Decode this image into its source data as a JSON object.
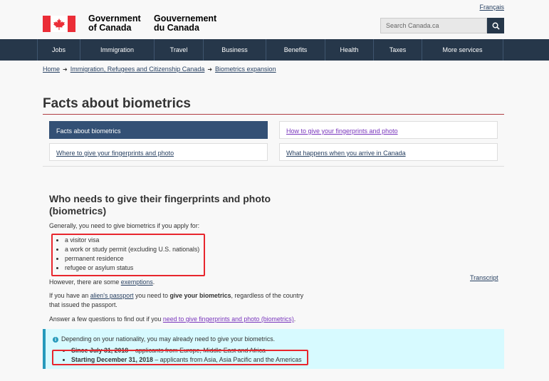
{
  "header": {
    "lang_link": "Français",
    "signature_en": [
      "Government",
      "of Canada"
    ],
    "signature_fr": [
      "Gouvernement",
      "du Canada"
    ],
    "search_placeholder": "Search Canada.ca"
  },
  "nav": [
    "Jobs",
    "Immigration",
    "Travel",
    "Business",
    "Benefits",
    "Health",
    "Taxes",
    "More services"
  ],
  "breadcrumb": [
    "Home",
    "Immigration, Refugees and Citizenship Canada",
    "Biometrics expansion"
  ],
  "page_title": "Facts about biometrics",
  "tiles": [
    {
      "label": "Facts about biometrics",
      "state": "active"
    },
    {
      "label": "How to give your fingerprints and photo",
      "state": "visited"
    },
    {
      "label": "Where to give your fingerprints and photo",
      "state": "link"
    },
    {
      "label": "What happens when you arrive in Canada",
      "state": "link"
    }
  ],
  "section": {
    "heading": "Who needs to give their fingerprints and photo (biometrics)",
    "intro": "Generally, you need to give biometrics if you apply for:",
    "list": [
      "a visitor visa",
      "a work or study permit (excluding U.S. nationals)",
      "permanent residence",
      "refugee or asylum status"
    ],
    "exemptions_pre": "However, there are some ",
    "exemptions_link": "exemptions",
    "exemptions_post": ".",
    "alien_pre": "If you have an ",
    "alien_link": "alien's passport",
    "alien_mid": " you need to ",
    "alien_bold": "give your biometrics",
    "alien_post": ", regardless of the country",
    "alien_line2": "that issued the passport.",
    "answer_pre": "Answer a few questions to find out if you ",
    "answer_link": "need to give fingerprints and photo (biometrics)",
    "answer_post": ".",
    "transcript": "Transcript"
  },
  "alert": {
    "text": "Depending on your nationality, you may already need to give your biometrics.",
    "items": [
      {
        "bold": "Since July 31, 2018",
        "rest": " – applicants from Europe, Middle East and Africa"
      },
      {
        "bold": "Starting December 31, 2018",
        "rest": " – applicants from Asia, Asia Pacific and the Americas"
      }
    ]
  }
}
